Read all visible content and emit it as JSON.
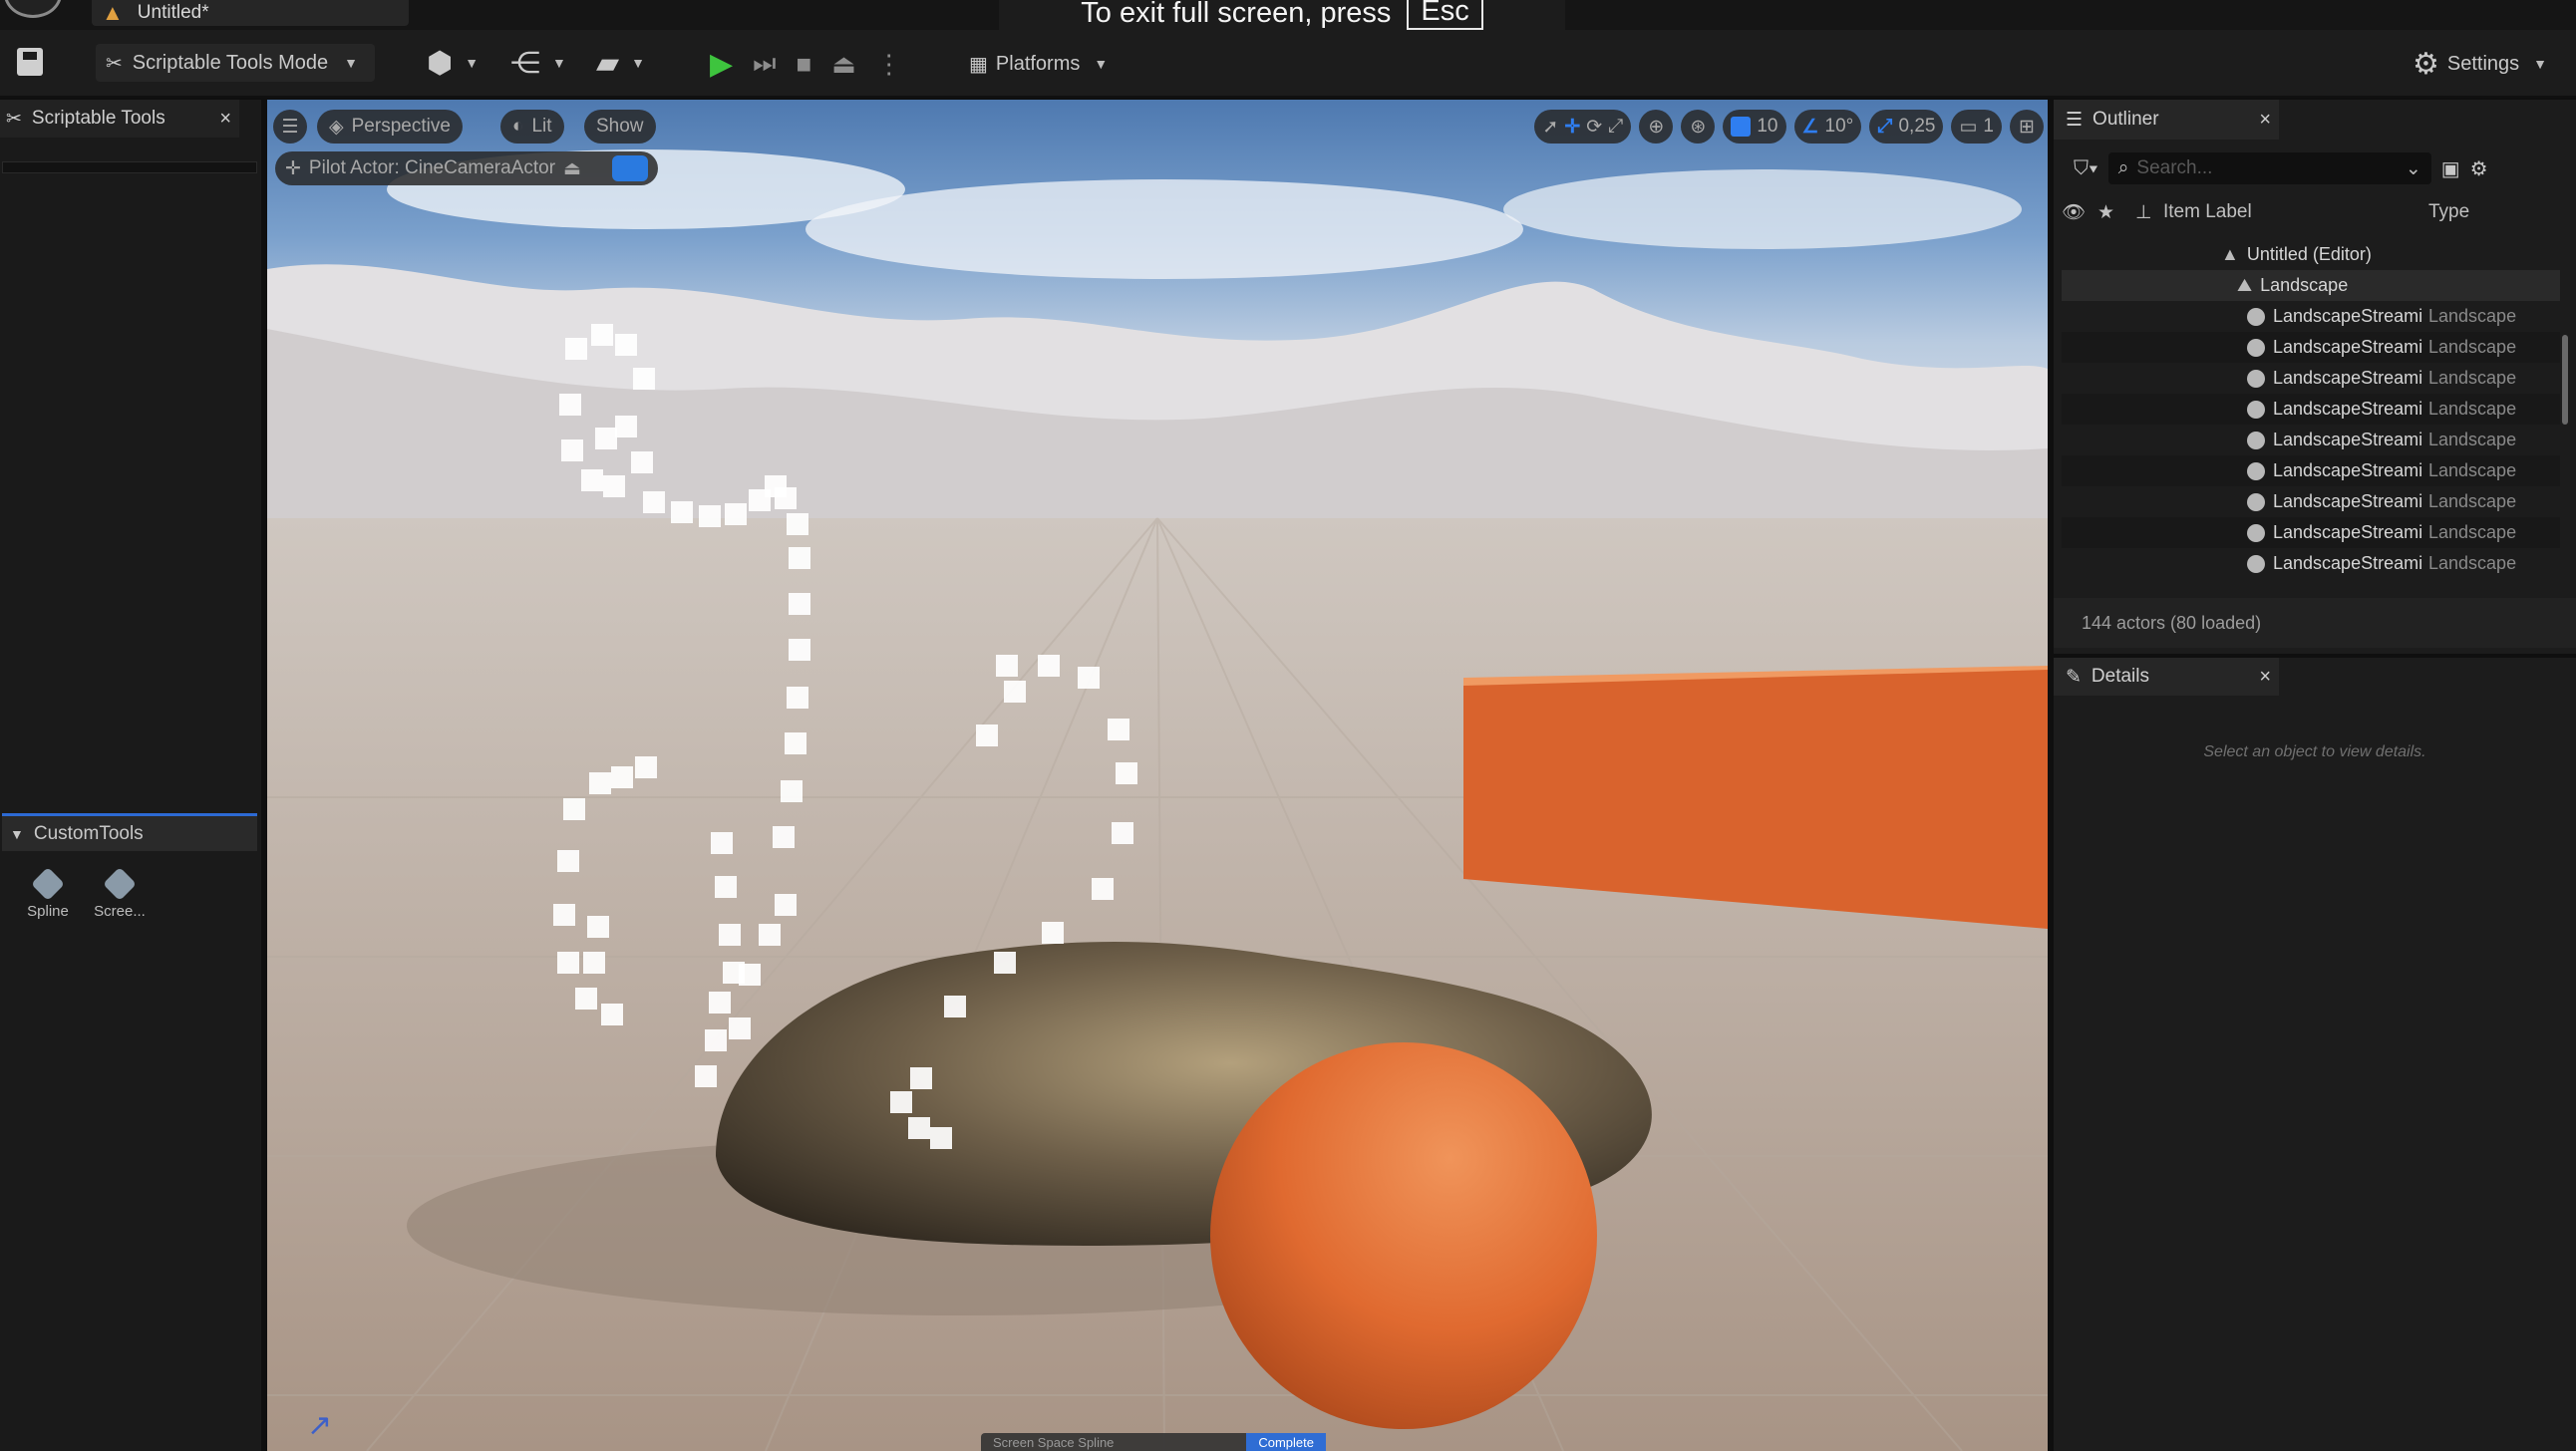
{
  "window": {
    "doc_tab": "Untitled*",
    "fullscreen_notice": {
      "text": "To exit full screen, press",
      "key": "Esc"
    }
  },
  "toolbar": {
    "mode_label": "Scriptable Tools Mode",
    "platforms_label": "Platforms",
    "settings_label": "Settings"
  },
  "left_panel": {
    "tab_title": "Scriptable Tools",
    "category": "CustomTools",
    "tools": [
      {
        "label": "Spline",
        "icon": "tool-icon"
      },
      {
        "label": "Scree...",
        "icon": "tool-icon"
      }
    ]
  },
  "viewport": {
    "menu_icon": "hamburger-icon",
    "view_mode": "Perspective",
    "lighting_mode": "Lit",
    "show_label": "Show",
    "pilot_actor": "Pilot Actor: CineCameraActor",
    "grid_snap": "10",
    "rotation_snap": "10°",
    "scale_snap": "0,25",
    "camera_speed": "1",
    "bottom_banner": {
      "label": "Screen Space Spline",
      "complete_label": "Complete"
    }
  },
  "outliner": {
    "tab_title": "Outliner",
    "search_placeholder": "Search...",
    "columns": {
      "label": "Item Label",
      "type": "Type"
    },
    "root": "Untitled (Editor)",
    "folder": "Landscape",
    "rows": [
      {
        "name": "LandscapeStreami",
        "type": "Landscape"
      },
      {
        "name": "LandscapeStreami",
        "type": "Landscape"
      },
      {
        "name": "LandscapeStreami",
        "type": "Landscape"
      },
      {
        "name": "LandscapeStreami",
        "type": "Landscape"
      },
      {
        "name": "LandscapeStreami",
        "type": "Landscape"
      },
      {
        "name": "LandscapeStreami",
        "type": "Landscape"
      },
      {
        "name": "LandscapeStreami",
        "type": "Landscape"
      },
      {
        "name": "LandscapeStreami",
        "type": "Landscape"
      },
      {
        "name": "LandscapeStreami",
        "type": "Landscape"
      }
    ],
    "status": "144 actors (80 loaded)"
  },
  "details": {
    "tab_title": "Details",
    "empty_text": "Select an object to view details."
  },
  "colors": {
    "accent": "#2f7ef0",
    "play": "#3ec43e",
    "orange": "#e06a30"
  }
}
